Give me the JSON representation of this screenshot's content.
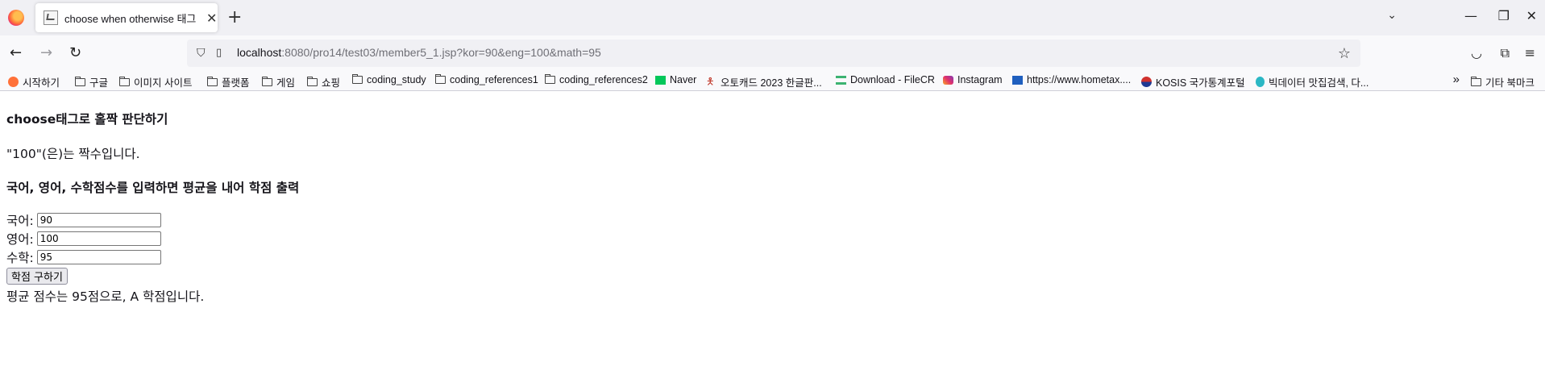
{
  "browser": {
    "tab_title": "choose when otherwise 태그",
    "url_host": "localhost",
    "url_rest": ":8080/pro14/test03/member5_1.jsp?kor=90&eng=100&math=95"
  },
  "bookmarks": [
    {
      "label": "시작하기",
      "icon": "firefox-icon"
    },
    {
      "label": "구글",
      "icon": "folder-icon"
    },
    {
      "label": "이미지 사이트",
      "icon": "folder-icon"
    },
    {
      "label": "플랫폼",
      "icon": "folder-icon"
    },
    {
      "label": "게임",
      "icon": "folder-icon"
    },
    {
      "label": "쇼핑",
      "icon": "folder-icon"
    },
    {
      "label": "coding_study",
      "icon": "folder-icon"
    },
    {
      "label": "coding_references1",
      "icon": "folder-icon"
    },
    {
      "label": "coding_references2",
      "icon": "folder-icon"
    },
    {
      "label": "Naver",
      "icon": "naver-icon"
    },
    {
      "label": "오토캐드 2023 한글판...",
      "icon": "person-icon"
    },
    {
      "label": "Download - FileCR",
      "icon": "filecr-icon"
    },
    {
      "label": "Instagram",
      "icon": "instagram-icon"
    },
    {
      "label": "https://www.hometax....",
      "icon": "hometax-icon"
    },
    {
      "label": "KOSIS 국가통계포털",
      "icon": "kosis-icon"
    },
    {
      "label": "빅데이터 맛집검색, 다...",
      "icon": "bigdata-icon"
    }
  ],
  "other_bookmarks": "기타 북마크",
  "page": {
    "choose_heading": "choose태그로 홀짝 판단하기",
    "parity_result": "\"100\"(은)는 짝수입니다.",
    "grade_heading": "국어, 영어, 수학점수를 입력하면 평균을 내어 학점 출력",
    "fields": [
      {
        "label": "국어:",
        "value": "90"
      },
      {
        "label": "영어:",
        "value": "100"
      },
      {
        "label": "수학:",
        "value": "95"
      }
    ],
    "submit_label": "학점 구하기",
    "average_result": "평균 점수는 95점으로, A 학점입니다."
  }
}
